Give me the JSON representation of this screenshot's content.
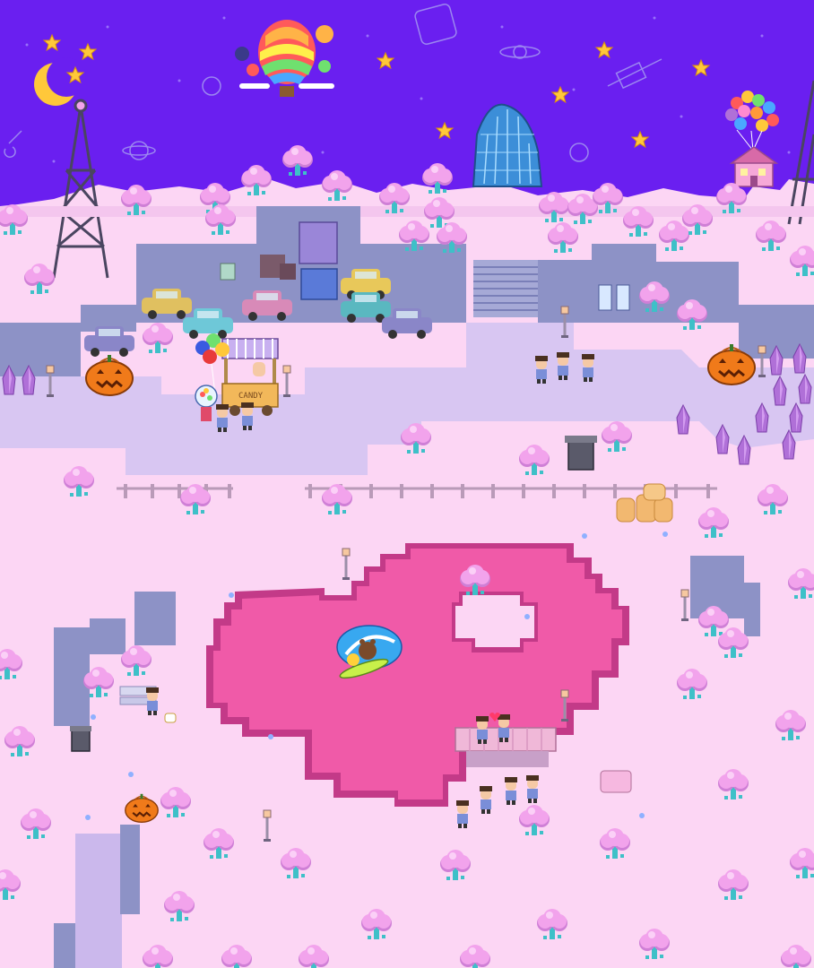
{
  "scene": {
    "palette": {
      "sky": "#6a1ff0",
      "sky_dark": "#5316d6",
      "ground": "#fcd6f4",
      "ground_shadow": "#e9c2ea",
      "path": "#d8c6f2",
      "cliff": "#8d92c6",
      "cliff_dark": "#6d74ac",
      "pond": "#f05aa8",
      "pond_edge": "#c33a88",
      "tree": "#f2a3ec",
      "tree_dark": "#cf7fd6",
      "trunk": "#3ec0c8",
      "crystal": "#b070d8",
      "star": "#ffc83a",
      "pumpkin": "#f07a1a"
    },
    "stand_sign": "CANDY",
    "icons": {
      "moon": "crescent-moon-icon",
      "balloon": "hot-air-balloon-icon",
      "tower": "radio-tower-icon",
      "house": "balloon-house-icon",
      "pumpkin": "jack-o-lantern-icon",
      "bin": "trash-can-icon",
      "satellite": "satellite-icon",
      "planet": "ringed-planet-icon"
    }
  }
}
